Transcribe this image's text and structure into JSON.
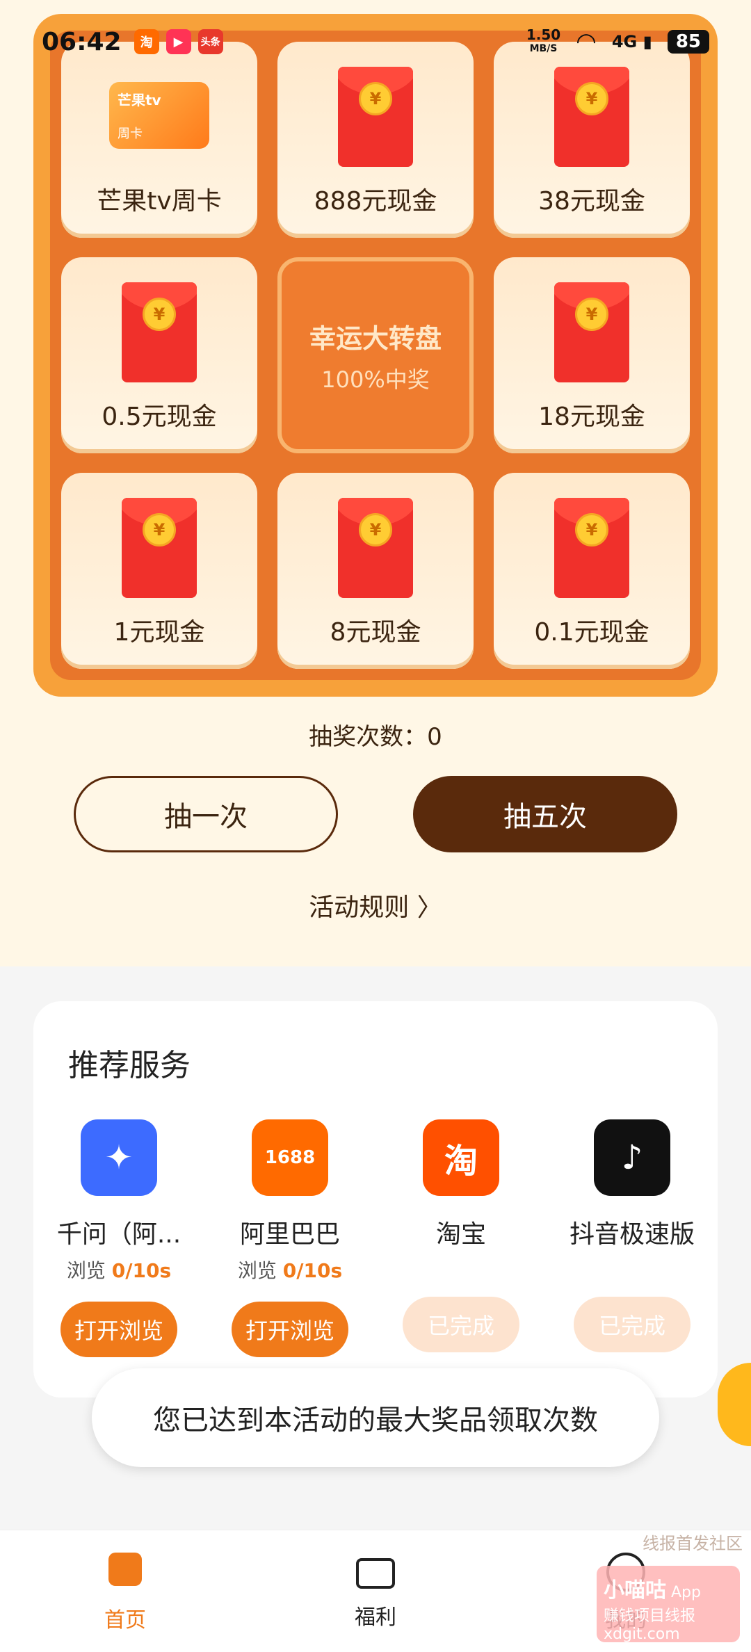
{
  "status": {
    "time": "06:42",
    "apps": [
      {
        "name": "淘",
        "color": "#ff6a00"
      },
      {
        "name": "▶",
        "color": "#ff3355"
      },
      {
        "name": "头条",
        "color": "#e8382c"
      }
    ],
    "speed_value": "1.50",
    "speed_unit": "MB/S",
    "network": "4G",
    "battery": "85"
  },
  "prizes": [
    {
      "label": "芒果tv周卡",
      "type": "card",
      "card_brand": "芒果tv",
      "card_sub": "周卡"
    },
    {
      "label": "888元现金",
      "type": "envelope"
    },
    {
      "label": "38元现金",
      "type": "envelope"
    },
    {
      "label": "0.5元现金",
      "type": "envelope"
    },
    {
      "label": "18元现金",
      "type": "envelope"
    },
    {
      "label": "1元现金",
      "type": "envelope"
    },
    {
      "label": "8元现金",
      "type": "envelope"
    },
    {
      "label": "0.1元现金",
      "type": "envelope"
    }
  ],
  "coin_symbol": "¥",
  "center": {
    "title": "幸运大转盘",
    "subtitle": "100%中奖"
  },
  "draw_count_label": "抽奖次数：",
  "draw_count_value": "0",
  "buttons": {
    "once": "抽一次",
    "five": "抽五次"
  },
  "rules_link": "活动规则 〉",
  "services": {
    "title": "推荐服务",
    "items": [
      {
        "name": "千问（阿...",
        "progress_label": "浏览",
        "progress_value": "0/10s",
        "button": "打开浏览",
        "state": "active",
        "icon_text": "✦",
        "icon_color": "#3d6bff"
      },
      {
        "name": "阿里巴巴",
        "progress_label": "浏览",
        "progress_value": "0/10s",
        "button": "打开浏览",
        "state": "active",
        "icon_text": "1688",
        "icon_color": "#ff6a00"
      },
      {
        "name": "淘宝",
        "progress_label": "",
        "progress_value": "",
        "button": "已完成",
        "state": "done",
        "icon_text": "淘",
        "icon_color": "#ff5000"
      },
      {
        "name": "抖音极速版",
        "progress_label": "",
        "progress_value": "",
        "button": "已完成",
        "state": "done",
        "icon_text": "♪",
        "icon_color": "#111111"
      }
    ]
  },
  "toast": "您已达到本活动的最大奖品领取次数",
  "nav": {
    "items": [
      {
        "label": "首页",
        "active": true
      },
      {
        "label": "福利",
        "active": false
      },
      {
        "label": "我的",
        "active": false
      }
    ]
  },
  "watermark": {
    "line1": "线报首发社区",
    "app_name": "小喵咕",
    "app_tag": "App",
    "slogan": "赚钱项目线报",
    "site": "xdgit.com"
  }
}
